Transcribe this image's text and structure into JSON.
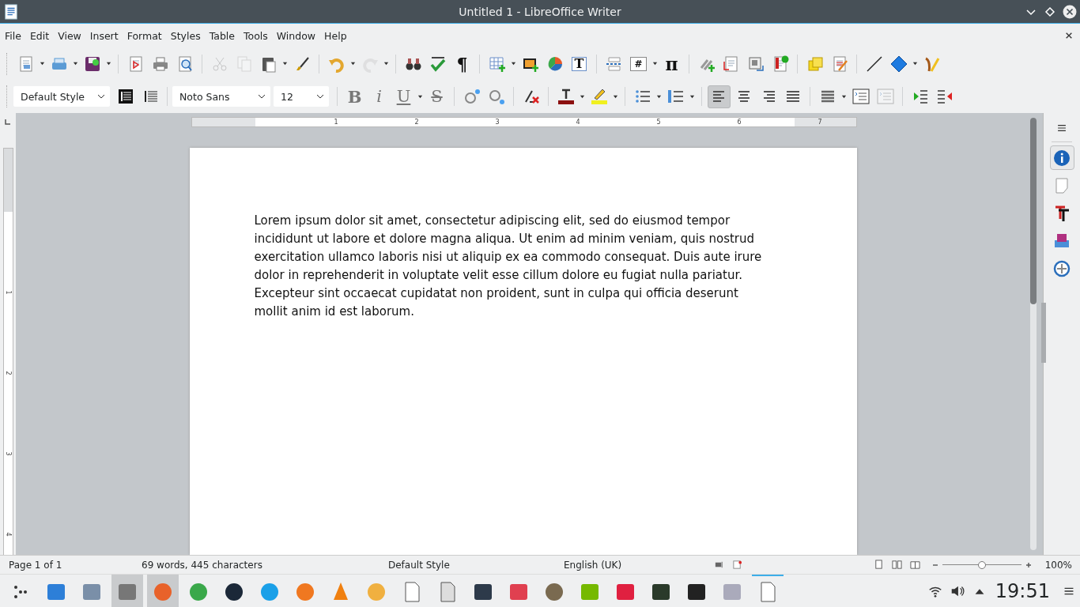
{
  "window": {
    "title": "Untitled 1 - LibreOffice Writer"
  },
  "menu": [
    "File",
    "Edit",
    "View",
    "Insert",
    "Format",
    "Styles",
    "Table",
    "Tools",
    "Window",
    "Help"
  ],
  "standard_toolbar": [
    {
      "disabled": false
    },
    {
      "disabled": false
    },
    {
      "disabled": false
    },
    {
      "disabled": false
    },
    {
      "disabled": false
    },
    {
      "disabled": false
    },
    {
      "disabled": true
    },
    {
      "disabled": true
    },
    {
      "disabled": false
    },
    {
      "disabled": false
    },
    {
      "disabled": false
    },
    {
      "disabled": true
    },
    {
      "disabled": false
    },
    {
      "disabled": false
    },
    {
      "glyph": "¶",
      "disabled": false
    },
    {
      "disabled": false
    },
    {
      "disabled": false
    },
    {
      "disabled": false
    },
    {
      "glyph": "T",
      "disabled": false
    },
    {
      "disabled": false
    },
    {
      "glyph": "#",
      "disabled": false
    },
    {
      "glyph": "π",
      "disabled": false
    },
    {
      "disabled": false
    },
    {
      "disabled": false
    },
    {
      "disabled": false
    },
    {
      "disabled": false
    },
    {
      "disabled": false
    },
    {
      "disabled": false
    },
    {
      "disabled": false
    },
    {
      "disabled": false
    },
    {
      "disabled": false
    }
  ],
  "formatting_toolbar": {
    "paragraph_style": "Default Style",
    "font_name": "Noto Sans",
    "font_size": "12",
    "character_format": [
      {
        "glyph": "B"
      },
      {
        "glyph": "i"
      },
      {
        "glyph": "U"
      },
      {
        "glyph": "S"
      }
    ],
    "alignment": [
      {
        "selected": true
      },
      {
        "selected": false
      },
      {
        "selected": false
      },
      {
        "selected": false
      }
    ],
    "spacing": [
      {
        "disabled": false
      },
      {
        "disabled": true
      }
    ]
  },
  "horizontal_ruler": [
    "1",
    "2",
    "3",
    "4",
    "5",
    "6",
    "7"
  ],
  "vertical_ruler": [
    "1",
    "2",
    "3",
    "4"
  ],
  "document": {
    "paragraph": "Lorem ipsum dolor sit amet, consectetur adipiscing elit, sed do eiusmod tempor incididunt ut labore et dolore magna aliqua. Ut enim ad minim veniam, quis nostrud exercitation ullamco laboris nisi ut aliquip ex ea commodo consequat. Duis aute irure dolor in reprehenderit in voluptate velit esse cillum dolore eu fugiat nulla pariatur. Excepteur sint occaecat cupidatat non proident, sunt in culpa qui officia deserunt mollit anim id est laborum."
  },
  "sidebar": [
    {
      "selected": true
    },
    {
      "selected": false
    },
    {
      "selected": false
    },
    {
      "selected": false
    },
    {
      "selected": false
    }
  ],
  "status_bar": {
    "page": "Page 1 of 1",
    "word_count": "69 words, 445 characters",
    "page_style": "Default Style",
    "language": "English (UK)",
    "zoom": {
      "level": 0.5
    },
    "zoom_percent": "100%"
  },
  "taskbar": [
    {
      "highlighted": false,
      "active": false
    },
    {
      "highlighted": false,
      "active": false
    },
    {
      "highlighted": false,
      "active": false
    },
    {
      "highlighted": true,
      "active": false
    },
    {
      "highlighted": true,
      "active": false
    },
    {
      "highlighted": false,
      "active": false
    },
    {
      "highlighted": false,
      "active": false
    },
    {
      "highlighted": false,
      "active": false
    },
    {
      "highlighted": false,
      "active": false
    },
    {
      "highlighted": false,
      "active": false
    },
    {
      "highlighted": false,
      "active": false
    },
    {
      "highlighted": false,
      "active": false
    },
    {
      "highlighted": false,
      "active": false
    },
    {
      "highlighted": false,
      "active": false
    },
    {
      "highlighted": false,
      "active": false
    },
    {
      "highlighted": false,
      "active": false
    },
    {
      "highlighted": false,
      "active": false
    },
    {
      "highlighted": false,
      "active": false
    },
    {
      "highlighted": false,
      "active": false
    },
    {
      "highlighted": false,
      "active": false
    },
    {
      "highlighted": false,
      "active": false
    },
    {
      "highlighted": false,
      "active": true
    }
  ],
  "clock": "19:51"
}
